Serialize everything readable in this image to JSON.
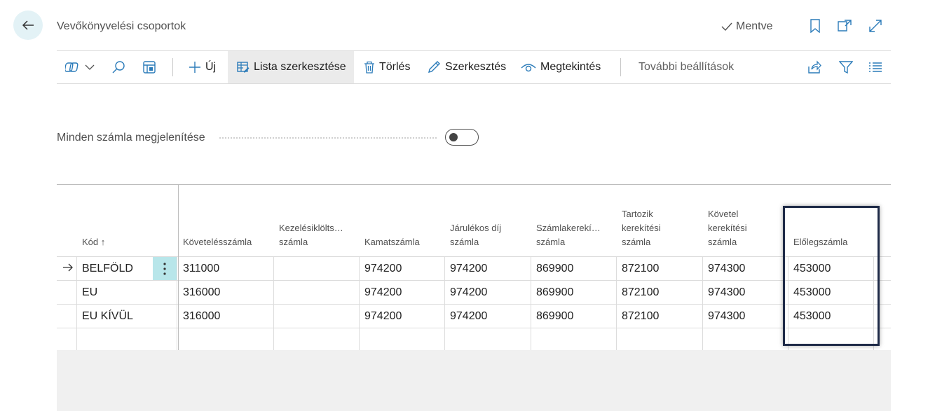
{
  "page": {
    "title": "Vevőkönyvelési csoportok",
    "saved_label": "Mentve"
  },
  "actions": {
    "new": "Új",
    "edit_list": "Lista szerkesztése",
    "delete": "Törlés",
    "edit": "Szerkesztés",
    "view": "Megtekintés",
    "more": "További beállítások"
  },
  "toggle": {
    "label": "Minden számla megjelenítése",
    "on": false
  },
  "table": {
    "columns": [
      [
        "Kód ↑"
      ],
      [
        "Követelésszámla"
      ],
      [
        "Kezelésiklölts…",
        "számla"
      ],
      [
        "Kamatszámla"
      ],
      [
        "Járulékos díj",
        "számla"
      ],
      [
        "Számlakerekí…",
        "számla"
      ],
      [
        "Tartozik",
        "kerekítési",
        "számla"
      ],
      [
        "Követel",
        "kerekítési",
        "számla"
      ],
      [
        "Előlegszámla"
      ]
    ],
    "rows": [
      [
        "BELFÖLD",
        "311000",
        "",
        "974200",
        "974200",
        "869900",
        "872100",
        "974300",
        "453000"
      ],
      [
        "EU",
        "316000",
        "",
        "974200",
        "974200",
        "869900",
        "872100",
        "974300",
        "453000"
      ],
      [
        "EU KÍVÜL",
        "316000",
        "",
        "974200",
        "974200",
        "869900",
        "872100",
        "974300",
        "453000"
      ],
      [
        "",
        "",
        "",
        "",
        "",
        "",
        "",
        "",
        ""
      ]
    ]
  },
  "colors": {
    "accent": "#b8e6ea",
    "highlight_border": "#1f2b48",
    "back_button_bg": "#e3f2f6"
  }
}
